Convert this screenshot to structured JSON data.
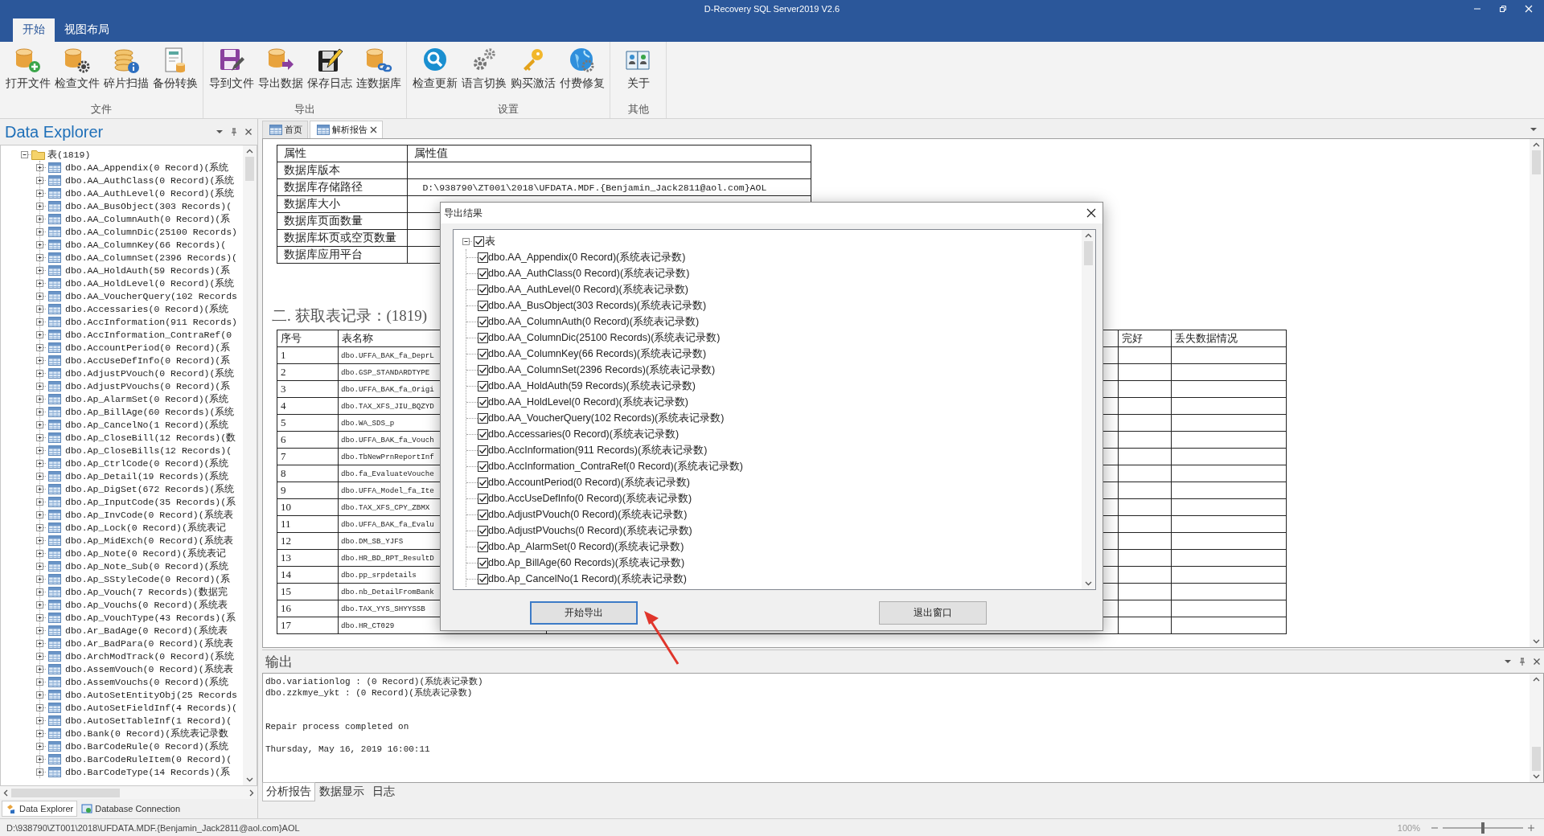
{
  "window": {
    "title": "D-Recovery SQL Server2019 V2.6"
  },
  "ribbon": {
    "tabs": [
      {
        "label": "开始",
        "selected": true
      },
      {
        "label": "视图布局",
        "selected": false
      }
    ],
    "groups": [
      {
        "label": "文件",
        "buttons": [
          "打开文件",
          "检查文件",
          "碎片扫描",
          "备份转换"
        ]
      },
      {
        "label": "导出",
        "buttons": [
          "导到文件",
          "导出数据",
          "保存日志",
          "连数据库"
        ]
      },
      {
        "label": "设置",
        "buttons": [
          "检查更新",
          "语言切换",
          "购买激活",
          "付费修复"
        ]
      },
      {
        "label": "其他",
        "buttons": [
          "关于"
        ]
      }
    ]
  },
  "explorer": {
    "title": "Data Explorer",
    "tree": {
      "label": "表(1819)",
      "expanded": true,
      "children": [
        {
          "label": "dbo.AA_Appendix(0 Record)(系统",
          "expanded": false
        },
        {
          "label": "dbo.AA_AuthClass(0 Record)(系统",
          "expanded": false
        },
        {
          "label": "dbo.AA_AuthLevel(0 Record)(系统",
          "expanded": false
        },
        {
          "label": "dbo.AA_BusObject(303 Records)(",
          "expanded": false
        },
        {
          "label": "dbo.AA_ColumnAuth(0 Record)(系",
          "expanded": false
        },
        {
          "label": "dbo.AA_ColumnDic(25100 Records)",
          "expanded": false
        },
        {
          "label": "dbo.AA_ColumnKey(66 Records)(",
          "expanded": false
        },
        {
          "label": "dbo.AA_ColumnSet(2396 Records)(",
          "expanded": false
        },
        {
          "label": "dbo.AA_HoldAuth(59 Records)(系",
          "expanded": false
        },
        {
          "label": "dbo.AA_HoldLevel(0 Record)(系统",
          "expanded": false
        },
        {
          "label": "dbo.AA_VoucherQuery(102 Records",
          "expanded": false
        },
        {
          "label": "dbo.Accessaries(0 Record)(系统",
          "expanded": false
        },
        {
          "label": "dbo.AccInformation(911 Records)",
          "expanded": false
        },
        {
          "label": "dbo.AccInformation_ContraRef(0",
          "expanded": false
        },
        {
          "label": "dbo.AccountPeriod(0 Record)(系",
          "expanded": false
        },
        {
          "label": "dbo.AccUseDefInfo(0 Record)(系",
          "expanded": false
        },
        {
          "label": "dbo.AdjustPVouch(0 Record)(系统",
          "expanded": false
        },
        {
          "label": "dbo.AdjustPVouchs(0 Record)(系",
          "expanded": false
        },
        {
          "label": "dbo.Ap_AlarmSet(0 Record)(系统",
          "expanded": false
        },
        {
          "label": "dbo.Ap_BillAge(60 Records)(系统",
          "expanded": false
        },
        {
          "label": "dbo.Ap_CancelNo(1 Record)(系统",
          "expanded": false
        },
        {
          "label": "dbo.Ap_CloseBill(12 Records)(数",
          "expanded": false
        },
        {
          "label": "dbo.Ap_CloseBills(12 Records)(",
          "expanded": false
        },
        {
          "label": "dbo.Ap_CtrlCode(0 Record)(系统",
          "expanded": false
        },
        {
          "label": "dbo.Ap_Detail(19 Records)(系统",
          "expanded": false
        },
        {
          "label": "dbo.Ap_DigSet(672 Records)(系统",
          "expanded": false
        },
        {
          "label": "dbo.Ap_InputCode(35 Records)(系",
          "expanded": false
        },
        {
          "label": "dbo.Ap_InvCode(0 Record)(系统表",
          "expanded": false
        },
        {
          "label": "dbo.Ap_Lock(0 Record)(系统表记",
          "expanded": false
        },
        {
          "label": "dbo.Ap_MidExch(0 Record)(系统表",
          "expanded": false
        },
        {
          "label": "dbo.Ap_Note(0 Record)(系统表记",
          "expanded": false
        },
        {
          "label": "dbo.Ap_Note_Sub(0 Record)(系统",
          "expanded": false
        },
        {
          "label": "dbo.Ap_SStyleCode(0 Record)(系",
          "expanded": false
        },
        {
          "label": "dbo.Ap_Vouch(7 Records)(数据完",
          "expanded": false
        },
        {
          "label": "dbo.Ap_Vouchs(0 Record)(系统表",
          "expanded": false
        },
        {
          "label": "dbo.Ap_VouchType(43 Records)(系",
          "expanded": false
        },
        {
          "label": "dbo.Ar_BadAge(0 Record)(系统表",
          "expanded": false
        },
        {
          "label": "dbo.Ar_BadPara(0 Record)(系统表",
          "expanded": false
        },
        {
          "label": "dbo.ArchModTrack(0 Record)(系统",
          "expanded": false
        },
        {
          "label": "dbo.AssemVouch(0 Record)(系统表",
          "expanded": false
        },
        {
          "label": "dbo.AssemVouchs(0 Record)(系统",
          "expanded": false
        },
        {
          "label": "dbo.AutoSetEntityObj(25 Records",
          "expanded": false
        },
        {
          "label": "dbo.AutoSetFieldInf(4 Records)(",
          "expanded": false
        },
        {
          "label": "dbo.AutoSetTableInf(1 Record)(",
          "expanded": false
        },
        {
          "label": "dbo.Bank(0 Record)(系统表记录数",
          "expanded": false
        },
        {
          "label": "dbo.BarCodeRule(0 Record)(系统",
          "expanded": false
        },
        {
          "label": "dbo.BarCodeRuleItem(0 Record)(",
          "expanded": false
        },
        {
          "label": "dbo.BarCodeType(14 Records)(系",
          "expanded": false
        }
      ]
    },
    "tabs": [
      {
        "label": "Data Explorer",
        "selected": true
      },
      {
        "label": "Database Connection",
        "selected": false
      }
    ]
  },
  "documents": {
    "tabs": [
      {
        "label": "首页",
        "selected": false
      },
      {
        "label": "解析报告",
        "selected": true
      }
    ]
  },
  "report": {
    "properties": {
      "columns": [
        "属性",
        "属性值"
      ],
      "rows": [
        {
          "name": "数据库版本"
        },
        {
          "name": "数据库存储路径",
          "value": "D:\\938790\\ZT001\\2018\\UFDATA.MDF.{Benjamin_Jack2811@aol.com}AOL"
        },
        {
          "name": "数据库大小"
        },
        {
          "name": "数据库页面数量"
        },
        {
          "name": "数据库坏页或空页数量"
        },
        {
          "name": "数据库应用平台"
        }
      ]
    },
    "heading": "二. 获取表记录：(1819)",
    "records": {
      "columns": [
        "序号",
        "表名称",
        "完好",
        "丢失数据情况"
      ],
      "rows": [
        [
          "1",
          "dbo.UFFA_BAK_fa_DeprL"
        ],
        [
          "2",
          "dbo.GSP_STANDARDTYPE"
        ],
        [
          "3",
          "dbo.UFFA_BAK_fa_Origi"
        ],
        [
          "4",
          "dbo.TAX_XFS_JIU_BQZYD"
        ],
        [
          "5",
          "dbo.WA_SDS_p"
        ],
        [
          "6",
          "dbo.UFFA_BAK_fa_Vouch"
        ],
        [
          "7",
          "dbo.TbNewPrnReportInf"
        ],
        [
          "8",
          "dbo.fa_EvaluateVouche"
        ],
        [
          "9",
          "dbo.UFFA_Model_fa_Ite"
        ],
        [
          "10",
          "dbo.TAX_XFS_CPY_ZBMX"
        ],
        [
          "11",
          "dbo.UFFA_BAK_fa_Evalu"
        ],
        [
          "12",
          "dbo.DM_SB_YJFS"
        ],
        [
          "13",
          "dbo.HR_BD_RPT_ResultD"
        ],
        [
          "14",
          "dbo.pp_srpdetails"
        ],
        [
          "15",
          "dbo.nb_DetailFromBank"
        ],
        [
          "16",
          "dbo.TAX_YYS_SHYYSSB"
        ],
        [
          "17",
          "dbo.HR_CT029"
        ]
      ]
    }
  },
  "dialog": {
    "title": "导出结果",
    "tree": {
      "label": "表",
      "checked": true,
      "expanded": true,
      "children": [
        {
          "label": "dbo.AA_Appendix(0 Record)(系统表记录数)",
          "checked": true
        },
        {
          "label": "dbo.AA_AuthClass(0 Record)(系统表记录数)",
          "checked": true
        },
        {
          "label": "dbo.AA_AuthLevel(0 Record)(系统表记录数)",
          "checked": true
        },
        {
          "label": "dbo.AA_BusObject(303 Records)(系统表记录数)",
          "checked": true
        },
        {
          "label": "dbo.AA_ColumnAuth(0 Record)(系统表记录数)",
          "checked": true
        },
        {
          "label": "dbo.AA_ColumnDic(25100 Records)(系统表记录数)",
          "checked": true
        },
        {
          "label": "dbo.AA_ColumnKey(66 Records)(系统表记录数)",
          "checked": true
        },
        {
          "label": "dbo.AA_ColumnSet(2396 Records)(系统表记录数)",
          "checked": true
        },
        {
          "label": "dbo.AA_HoldAuth(59 Records)(系统表记录数)",
          "checked": true
        },
        {
          "label": "dbo.AA_HoldLevel(0 Record)(系统表记录数)",
          "checked": true
        },
        {
          "label": "dbo.AA_VoucherQuery(102 Records)(系统表记录数)",
          "checked": true
        },
        {
          "label": "dbo.Accessaries(0 Record)(系统表记录数)",
          "checked": true
        },
        {
          "label": "dbo.AccInformation(911 Records)(系统表记录数)",
          "checked": true
        },
        {
          "label": "dbo.AccInformation_ContraRef(0 Record)(系统表记录数)",
          "checked": true
        },
        {
          "label": "dbo.AccountPeriod(0 Record)(系统表记录数)",
          "checked": true
        },
        {
          "label": "dbo.AccUseDefInfo(0 Record)(系统表记录数)",
          "checked": true
        },
        {
          "label": "dbo.AdjustPVouch(0 Record)(系统表记录数)",
          "checked": true
        },
        {
          "label": "dbo.AdjustPVouchs(0 Record)(系统表记录数)",
          "checked": true
        },
        {
          "label": "dbo.Ap_AlarmSet(0 Record)(系统表记录数)",
          "checked": true
        },
        {
          "label": "dbo.Ap_BillAge(60 Records)(系统表记录数)",
          "checked": true
        },
        {
          "label": "dbo.Ap_CancelNo(1 Record)(系统表记录数)",
          "checked": true
        }
      ]
    },
    "buttons": [
      {
        "label": "开始导出",
        "focused": true
      },
      {
        "label": "退出窗口",
        "focused": false
      }
    ]
  },
  "output": {
    "title": "输出",
    "lines": [
      "dbo.variationlog : (0 Record)(系统表记录数)",
      "dbo.zzkmye_ykt : (0 Record)(系统表记录数)"
    ],
    "message": "Repair process completed on",
    "timestamp": "Thursday, May 16, 2019 16:00:11",
    "tabs": [
      {
        "label": "分析报告",
        "selected": true
      },
      {
        "label": "数据显示",
        "selected": false
      },
      {
        "label": "日志",
        "selected": false
      }
    ]
  },
  "status_bar": {
    "path": "D:\\938790\\ZT001\\2018\\UFDATA.MDF.{Benjamin_Jack2811@aol.com}AOL",
    "zoom": "100%",
    "level": 0.5
  }
}
